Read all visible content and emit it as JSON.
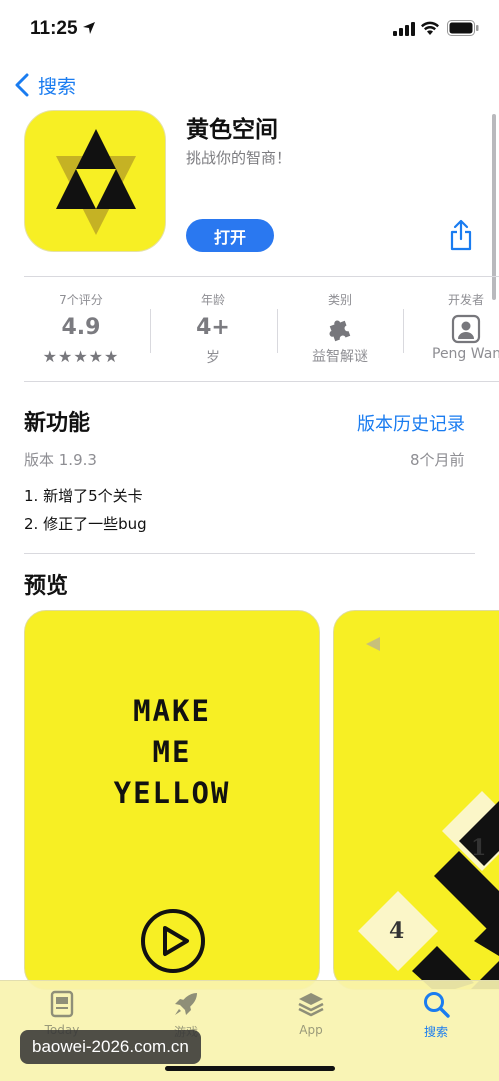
{
  "status": {
    "time": "11:25"
  },
  "nav": {
    "back_label": "搜索"
  },
  "app": {
    "title": "黄色空间",
    "subtitle": "挑战你的智商！",
    "open_label": "打开"
  },
  "stats": [
    {
      "label": "7个评分",
      "value": "4.9",
      "stars": "★★★★★"
    },
    {
      "label": "年龄",
      "value": "4+",
      "sub": "岁"
    },
    {
      "label": "类别",
      "icon": "puzzle-icon",
      "sub": "益智解谜"
    },
    {
      "label": "开发者",
      "icon": "person-icon",
      "sub": "Peng Wan"
    }
  ],
  "whats_new": {
    "title": "新功能",
    "history_link": "版本历史记录",
    "version": "版本 1.9.3",
    "time_ago": "8个月前",
    "notes": [
      "1. 新增了5个关卡",
      "2. 修正了一些bug"
    ]
  },
  "preview": {
    "title": "预览",
    "shot1_lines": [
      "MAKE",
      "ME",
      "YELLOW"
    ],
    "shot2_tiles": [
      "1",
      "4"
    ]
  },
  "tabs": [
    {
      "label": "Today",
      "icon": "today-icon"
    },
    {
      "label": "游戏",
      "icon": "rocket-icon"
    },
    {
      "label": "App",
      "icon": "layers-icon"
    },
    {
      "label": "搜索",
      "icon": "search-icon",
      "active": true
    }
  ],
  "watermark": "baowei-2026.com.cn",
  "colors": {
    "accent": "#1a7cf0",
    "icon_yellow": "#f7ef24"
  }
}
